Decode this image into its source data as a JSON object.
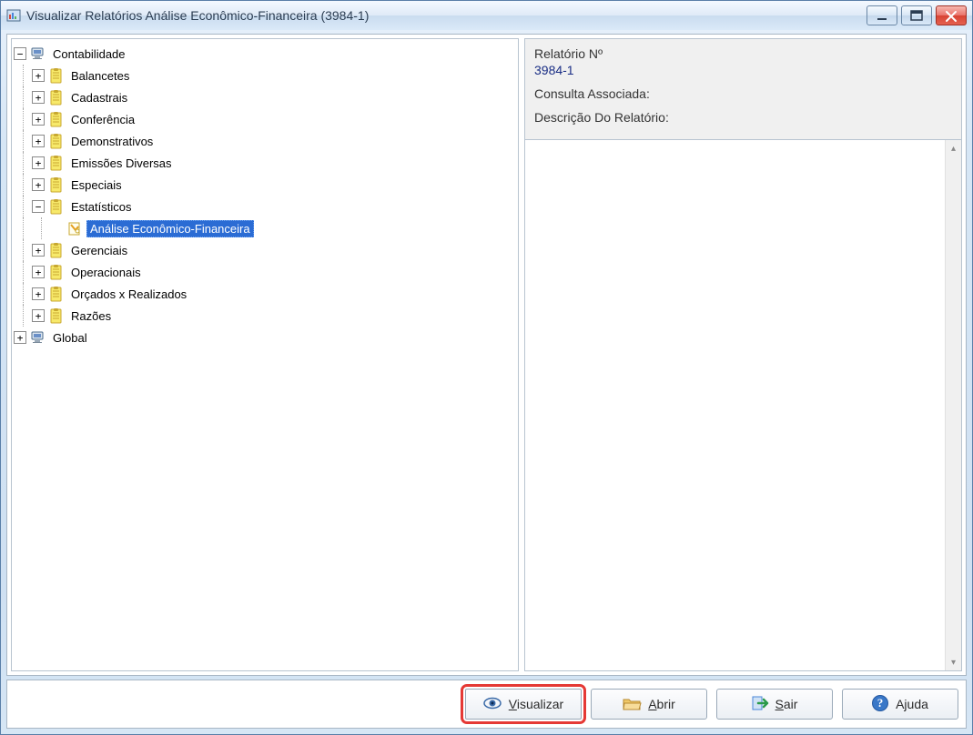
{
  "window": {
    "title": "Visualizar Relatórios Análise Econômico-Financeira (3984-1)"
  },
  "info": {
    "label_report_no": "Relatório Nº",
    "report_no": "3984-1",
    "label_consulta": "Consulta Associada:",
    "consulta_value": "",
    "label_desc": "Descrição Do Relatório:",
    "desc_value": ""
  },
  "tree": {
    "root1": {
      "label": "Contabilidade",
      "expander": "−",
      "icon": "computer"
    },
    "root1_children": [
      {
        "label": "Balancetes",
        "expander": "+",
        "icon": "clipboard"
      },
      {
        "label": "Cadastrais",
        "expander": "+",
        "icon": "clipboard"
      },
      {
        "label": "Conferência",
        "expander": "+",
        "icon": "clipboard"
      },
      {
        "label": "Demonstrativos",
        "expander": "+",
        "icon": "clipboard"
      },
      {
        "label": "Emissões Diversas",
        "expander": "+",
        "icon": "clipboard"
      },
      {
        "label": "Especiais",
        "expander": "+",
        "icon": "clipboard"
      },
      {
        "label": "Estatísticos",
        "expander": "−",
        "icon": "clipboard"
      }
    ],
    "estatisticos_child": {
      "label": "Análise Econômico-Financeira",
      "expander": "",
      "icon": "report",
      "selected": true
    },
    "root1_children2": [
      {
        "label": "Gerenciais",
        "expander": "+",
        "icon": "clipboard"
      },
      {
        "label": "Operacionais",
        "expander": "+",
        "icon": "clipboard"
      },
      {
        "label": "Orçados x Realizados",
        "expander": "+",
        "icon": "clipboard"
      },
      {
        "label": "Razões",
        "expander": "+",
        "icon": "clipboard"
      }
    ],
    "root2": {
      "label": "Global",
      "expander": "+",
      "icon": "computer"
    }
  },
  "buttons": {
    "visualizar": "Visualizar",
    "abrir": "Abrir",
    "sair": "Sair",
    "ajuda": "Ajuda"
  }
}
